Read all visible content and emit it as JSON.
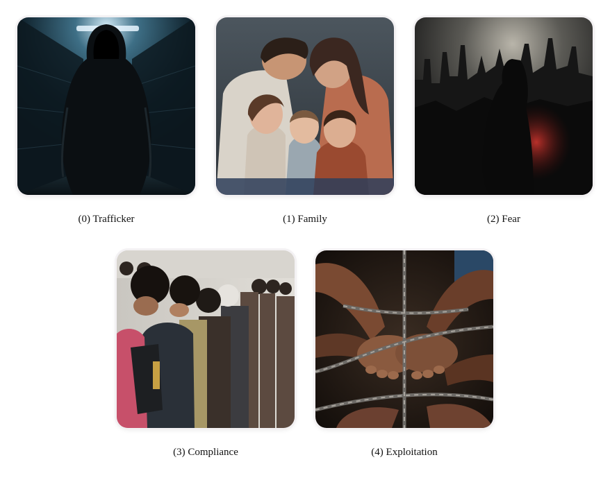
{
  "figure": {
    "panels": [
      {
        "caption": "(0) Trafficker",
        "image_subject": "hooded-figure-in-corridor"
      },
      {
        "caption": "(1) Family",
        "image_subject": "family-embrace"
      },
      {
        "caption": "(2) Fear",
        "image_subject": "shadow-figure-dark-city"
      },
      {
        "caption": "(3) Compliance",
        "image_subject": "line-of-people-heads-bowed"
      },
      {
        "caption": "(4) Exploitation",
        "image_subject": "chained-hands"
      }
    ]
  }
}
